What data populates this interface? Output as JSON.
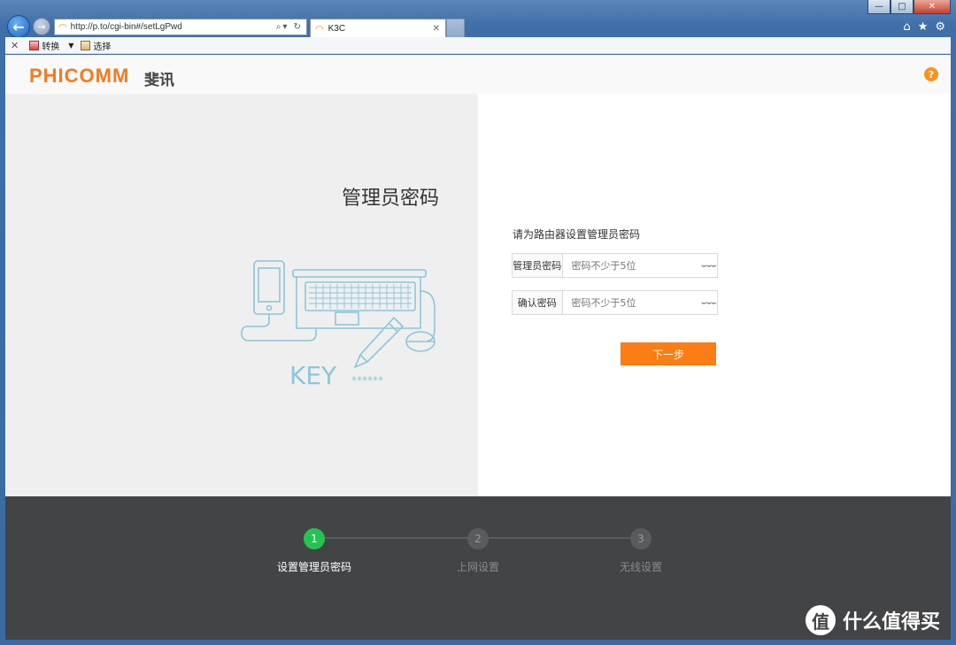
{
  "browser": {
    "url": "http://p.to/cgi-bin#/setLgPwd",
    "tab_title": "K3C",
    "command_bar": {
      "convert_label": "转换",
      "select_label": "选择"
    },
    "icons": [
      "back-arrow-icon",
      "forward-arrow-icon",
      "wifi-icon",
      "search-icon",
      "refresh-icon",
      "home-icon",
      "star-icon",
      "gear-icon"
    ]
  },
  "header": {
    "logo_text": "PHICOMM",
    "logo_cn": "斐讯",
    "help_symbol": "?"
  },
  "left": {
    "title": "管理员密码",
    "illustration_text": "KEY",
    "illustration_stars": "******"
  },
  "form": {
    "instruction": "请为路由器设置管理员密码",
    "fields": [
      {
        "label": "管理员密码",
        "placeholder": "密码不少于5位"
      },
      {
        "label": "确认密码",
        "placeholder": "密码不少于5位"
      }
    ],
    "next_label": "下一步"
  },
  "steps": [
    {
      "number": "1",
      "label": "设置管理员密码",
      "active": true
    },
    {
      "number": "2",
      "label": "上网设置",
      "active": false
    },
    {
      "number": "3",
      "label": "无线设置",
      "active": false
    }
  ],
  "watermark": {
    "badge": "值",
    "text": "什么值得买"
  },
  "colors": {
    "brand": "#f47a20",
    "button": "#fb7d13",
    "step_active": "#24c451",
    "footer": "#434446",
    "illustration": "#8cc6d9"
  }
}
